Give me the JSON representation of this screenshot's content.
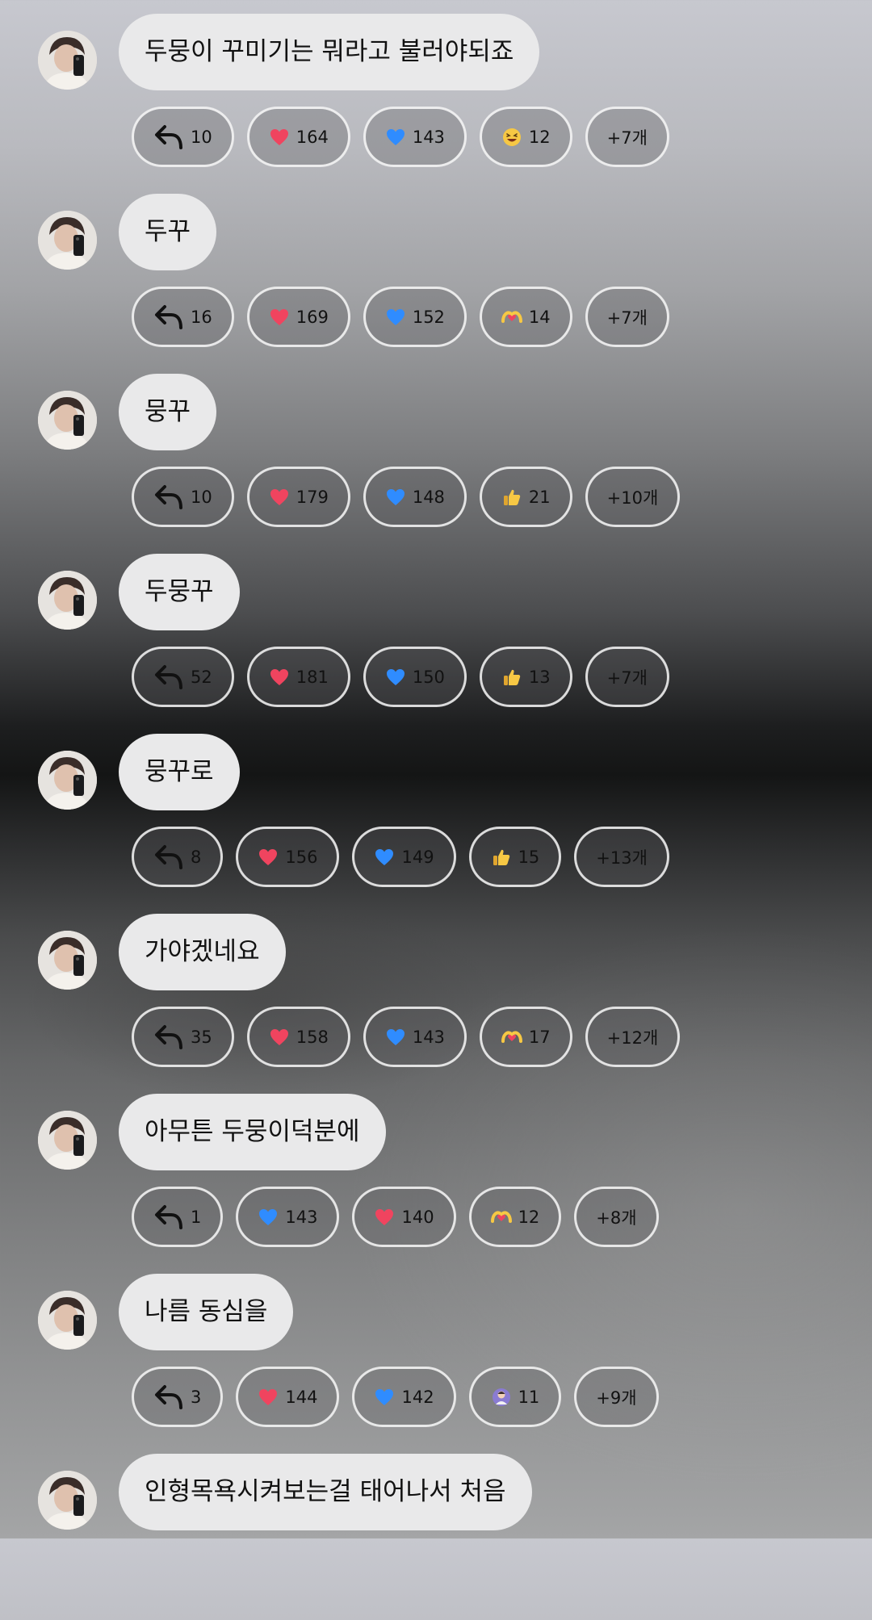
{
  "messages": [
    {
      "text": "두뭉이 꾸미기는 뭐라고 불러야되죠",
      "reactions": [
        {
          "icon": "reply-arrow-icon",
          "count": "10"
        },
        {
          "icon": "red-heart-icon",
          "count": "164"
        },
        {
          "icon": "blue-heart-icon",
          "count": "143"
        },
        {
          "icon": "laughing-face-icon",
          "count": "12"
        }
      ],
      "more": "+7개"
    },
    {
      "text": "두꾸",
      "reactions": [
        {
          "icon": "reply-arrow-icon",
          "count": "16"
        },
        {
          "icon": "red-heart-icon",
          "count": "169"
        },
        {
          "icon": "blue-heart-icon",
          "count": "152"
        },
        {
          "icon": "heart-hands-icon",
          "count": "14"
        }
      ],
      "more": "+7개"
    },
    {
      "text": "뭉꾸",
      "reactions": [
        {
          "icon": "reply-arrow-icon",
          "count": "10"
        },
        {
          "icon": "red-heart-icon",
          "count": "179"
        },
        {
          "icon": "blue-heart-icon",
          "count": "148"
        },
        {
          "icon": "thumbs-up-icon",
          "count": "21"
        }
      ],
      "more": "+10개"
    },
    {
      "text": "두뭉꾸",
      "reactions": [
        {
          "icon": "reply-arrow-icon",
          "count": "52"
        },
        {
          "icon": "red-heart-icon",
          "count": "181"
        },
        {
          "icon": "blue-heart-icon",
          "count": "150"
        },
        {
          "icon": "thumbs-up-icon",
          "count": "13"
        }
      ],
      "more": "+7개"
    },
    {
      "text": "뭉꾸로",
      "reactions": [
        {
          "icon": "reply-arrow-icon",
          "count": "8"
        },
        {
          "icon": "red-heart-icon",
          "count": "156"
        },
        {
          "icon": "blue-heart-icon",
          "count": "149"
        },
        {
          "icon": "thumbs-up-icon",
          "count": "15"
        }
      ],
      "more": "+13개"
    },
    {
      "text": "가야겠네요",
      "reactions": [
        {
          "icon": "reply-arrow-icon",
          "count": "35"
        },
        {
          "icon": "red-heart-icon",
          "count": "158"
        },
        {
          "icon": "blue-heart-icon",
          "count": "143"
        },
        {
          "icon": "heart-hands-icon",
          "count": "17"
        }
      ],
      "more": "+12개"
    },
    {
      "text": "아무튼 두뭉이덕분에",
      "reactions": [
        {
          "icon": "reply-arrow-icon",
          "count": "1"
        },
        {
          "icon": "blue-heart-icon",
          "count": "143"
        },
        {
          "icon": "red-heart-icon",
          "count": "140"
        },
        {
          "icon": "heart-hands-icon",
          "count": "12"
        }
      ],
      "more": "+8개"
    },
    {
      "text": "나름 동심을",
      "reactions": [
        {
          "icon": "reply-arrow-icon",
          "count": "3"
        },
        {
          "icon": "red-heart-icon",
          "count": "144"
        },
        {
          "icon": "blue-heart-icon",
          "count": "142"
        },
        {
          "icon": "person-gesturing-icon",
          "count": "11"
        }
      ],
      "more": "+9개"
    },
    {
      "text": "인형목욕시켜보는걸 태어나서 처음",
      "reactions": [],
      "more": ""
    }
  ],
  "colors": {
    "bubble": "#e9e9ea",
    "chip_border": "#ffffff",
    "red_heart": "#f0445f",
    "blue_heart": "#2f8cff",
    "emoji_yellow": "#f7c844"
  }
}
